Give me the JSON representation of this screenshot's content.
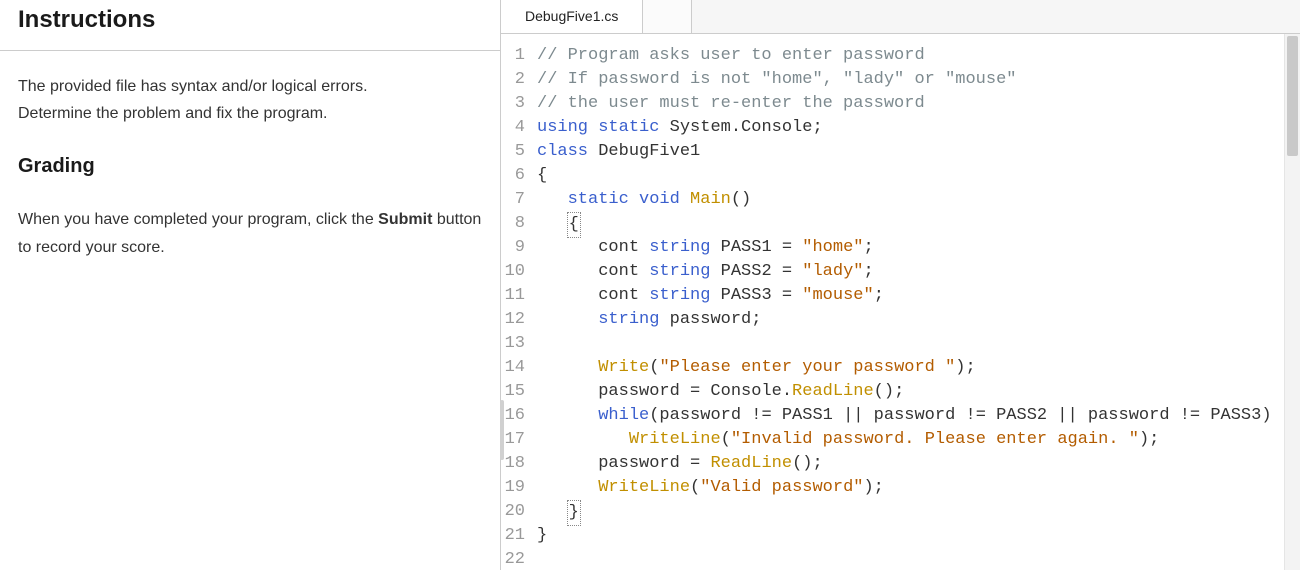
{
  "left": {
    "heading1": "Instructions",
    "para1a": "The provided file has syntax and/or logical errors.",
    "para1b": "Determine the problem and fix the program.",
    "heading2": "Grading",
    "para2a": "When you have completed your program, click the ",
    "submit_label": "Submit",
    "para2b": " button to record your score."
  },
  "tabs": {
    "file_tab": "DebugFive1.cs"
  },
  "code": {
    "lines": [
      {
        "n": "1",
        "seg": [
          {
            "t": "// Program asks user to enter password",
            "c": "tok-comment"
          }
        ]
      },
      {
        "n": "2",
        "seg": [
          {
            "t": "// If password is not \"home\", \"lady\" or \"mouse\"",
            "c": "tok-comment"
          }
        ]
      },
      {
        "n": "3",
        "seg": [
          {
            "t": "// the user must re-enter the password",
            "c": "tok-comment"
          }
        ]
      },
      {
        "n": "4",
        "seg": [
          {
            "t": "using",
            "c": "tok-kw"
          },
          {
            "t": " "
          },
          {
            "t": "static",
            "c": "tok-kw"
          },
          {
            "t": " System.Console;",
            "c": "tok-class"
          }
        ]
      },
      {
        "n": "5",
        "seg": [
          {
            "t": "class",
            "c": "tok-kw"
          },
          {
            "t": " DebugFive1",
            "c": "tok-class"
          }
        ]
      },
      {
        "n": "6",
        "seg": [
          {
            "t": "{",
            "c": "tok-punct"
          }
        ]
      },
      {
        "n": "7",
        "seg": [
          {
            "t": "   "
          },
          {
            "t": "static",
            "c": "tok-kw"
          },
          {
            "t": " "
          },
          {
            "t": "void",
            "c": "tok-kw"
          },
          {
            "t": " "
          },
          {
            "t": "Main",
            "c": "tok-method"
          },
          {
            "t": "()",
            "c": "tok-punct"
          }
        ]
      },
      {
        "n": "8",
        "seg": [
          {
            "t": "   "
          },
          {
            "t": "{",
            "c": "tok-punct",
            "box": true
          }
        ]
      },
      {
        "n": "9",
        "seg": [
          {
            "t": "      cont "
          },
          {
            "t": "string",
            "c": "tok-kw"
          },
          {
            "t": " PASS1 = "
          },
          {
            "t": "\"home\"",
            "c": "tok-str"
          },
          {
            "t": ";"
          }
        ]
      },
      {
        "n": "10",
        "seg": [
          {
            "t": "      cont "
          },
          {
            "t": "string",
            "c": "tok-kw"
          },
          {
            "t": " PASS2 = "
          },
          {
            "t": "\"lady\"",
            "c": "tok-str"
          },
          {
            "t": ";"
          }
        ]
      },
      {
        "n": "11",
        "seg": [
          {
            "t": "      cont "
          },
          {
            "t": "string",
            "c": "tok-kw"
          },
          {
            "t": " PASS3 = "
          },
          {
            "t": "\"mouse\"",
            "c": "tok-str"
          },
          {
            "t": ";"
          }
        ]
      },
      {
        "n": "12",
        "seg": [
          {
            "t": "      "
          },
          {
            "t": "string",
            "c": "tok-kw"
          },
          {
            "t": " password;"
          }
        ]
      },
      {
        "n": "13",
        "seg": [
          {
            "t": " "
          }
        ]
      },
      {
        "n": "14",
        "seg": [
          {
            "t": "      "
          },
          {
            "t": "Write",
            "c": "tok-method"
          },
          {
            "t": "("
          },
          {
            "t": "\"Please enter your password \"",
            "c": "tok-str"
          },
          {
            "t": ");"
          }
        ]
      },
      {
        "n": "15",
        "seg": [
          {
            "t": "      password = Console."
          },
          {
            "t": "ReadLine",
            "c": "tok-method"
          },
          {
            "t": "();"
          }
        ]
      },
      {
        "n": "16",
        "seg": [
          {
            "t": "      "
          },
          {
            "t": "while",
            "c": "tok-kw"
          },
          {
            "t": "(password != PASS1 || password != PASS2 || password != PASS3)"
          }
        ]
      },
      {
        "n": "17",
        "seg": [
          {
            "t": "         "
          },
          {
            "t": "WriteLine",
            "c": "tok-method"
          },
          {
            "t": "("
          },
          {
            "t": "\"Invalid password. Please enter again. \"",
            "c": "tok-str"
          },
          {
            "t": ");"
          }
        ]
      },
      {
        "n": "18",
        "seg": [
          {
            "t": "      password = "
          },
          {
            "t": "ReadLine",
            "c": "tok-method"
          },
          {
            "t": "();"
          }
        ]
      },
      {
        "n": "19",
        "seg": [
          {
            "t": "      "
          },
          {
            "t": "WriteLine",
            "c": "tok-method"
          },
          {
            "t": "("
          },
          {
            "t": "\"Valid password\"",
            "c": "tok-str"
          },
          {
            "t": ");"
          }
        ]
      },
      {
        "n": "20",
        "seg": [
          {
            "t": "   "
          },
          {
            "t": "}",
            "c": "tok-punct",
            "box": true
          }
        ]
      },
      {
        "n": "21",
        "seg": [
          {
            "t": "}",
            "c": "tok-punct"
          }
        ]
      },
      {
        "n": "22",
        "seg": [
          {
            "t": " "
          }
        ]
      }
    ]
  }
}
